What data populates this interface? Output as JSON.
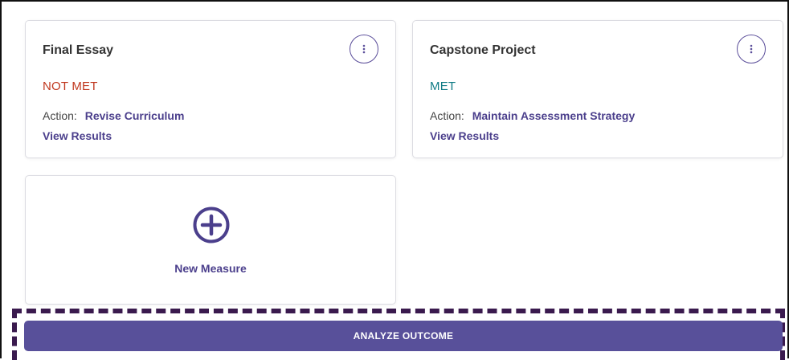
{
  "measures": [
    {
      "title": "Final Essay",
      "status": "NOT MET",
      "action_label": "Action:",
      "action_value": "Revise Curriculum",
      "view_link": "View Results"
    },
    {
      "title": "Capstone Project",
      "status": "MET",
      "action_label": "Action:",
      "action_value": "Maintain Assessment Strategy",
      "view_link": "View Results"
    }
  ],
  "new_measure": {
    "label": "New Measure",
    "icon": "plus-circle-icon"
  },
  "analyze_button": {
    "label": "ANALYZE OUTCOME"
  },
  "icons": {
    "menu": "more-vertical-icon"
  },
  "colors": {
    "accent": "#4b3f8c",
    "button": "#58509a",
    "not_met": "#c0381f",
    "met": "#117c86",
    "highlight_border": "#3a1a4e"
  }
}
